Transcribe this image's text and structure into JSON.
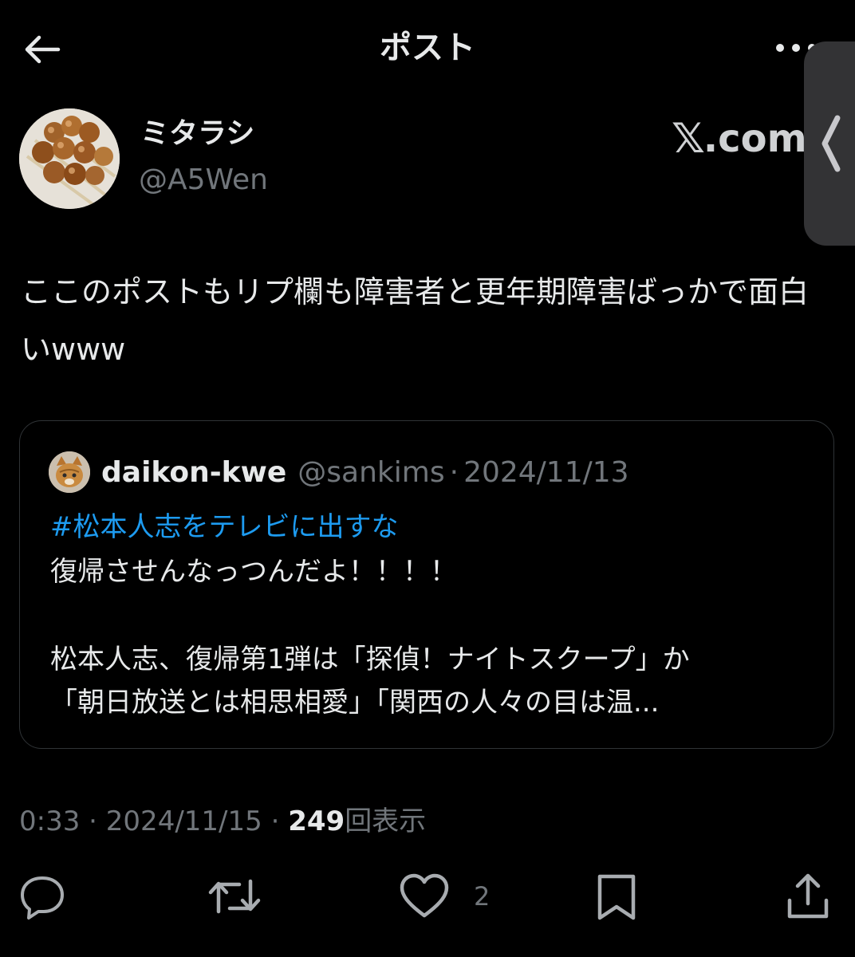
{
  "header": {
    "title": "ポスト",
    "back_icon": "arrow-left-icon",
    "more_icon": "more-horizontal-icon"
  },
  "side_handle": {
    "icon": "chevron-left-icon"
  },
  "author": {
    "name": "ミタラシ",
    "handle": "@A5Wen",
    "avatar": "avatar-dango-image"
  },
  "watermark": {
    "x": "𝕏",
    "rest": ".com"
  },
  "post": {
    "text": "ここのポストもリプ欄も障害者と更年期障害ばっかで面白いwww"
  },
  "quote": {
    "name": "daikon-kwe",
    "handle": "@sankims",
    "separator": "·",
    "date": "2024/11/13",
    "hashtag": "#松本人志をテレビに出すな",
    "line1": "復帰させんなっつんだよ！！！！",
    "line2": "松本人志、復帰第1弾は「探偵！ナイトスクープ」か",
    "line3": "「朝日放送とは相思相愛」「関西の人々の目は温..."
  },
  "meta": {
    "time": "0:33",
    "separator": "·",
    "date": "2024/11/15",
    "views_count": "249",
    "views_label": "回表示"
  },
  "actions": {
    "reply_icon": "reply-icon",
    "repost_icon": "repost-icon",
    "like_icon": "heart-icon",
    "like_count": "2",
    "bookmark_icon": "bookmark-icon",
    "share_icon": "share-icon"
  },
  "colors": {
    "background": "#000000",
    "text": "#e7e9ea",
    "secondary": "#71767b",
    "link": "#1d9bf0",
    "border": "#2f3336"
  }
}
